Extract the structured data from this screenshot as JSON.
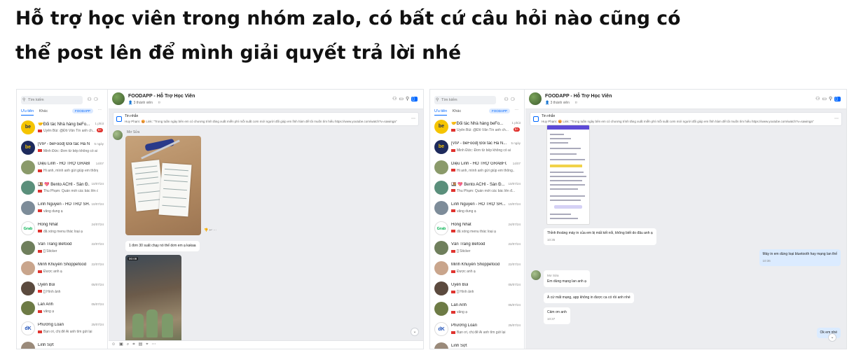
{
  "headline": {
    "line1": "Hỗ trợ học viên trong nhóm zalo, có bất cứ câu hỏi nào cũng có",
    "line2": "thể post lên để mình giải quyết trả lời nhé"
  },
  "sidebar": {
    "search_placeholder": "Tìm kiếm",
    "tab_priority": "Ưu tiên",
    "tab_other": "Khác",
    "label_filter": "FOODAPP",
    "conversations": [
      {
        "avatar": "be",
        "avatar_color": "#f5c400",
        "name": "🤝Đối tác Nhà hàng beFo...",
        "preview": "Uyên Bùi: @Đỗ Văn Tín anh ch...",
        "time": "1 phút",
        "badge": "5+"
      },
      {
        "avatar": "be",
        "avatar_color": "#1d2a5c",
        "name": "[VIP - beFood] Đối tác Hà N...",
        "preview": "Minh Đức: Đơn từ bếp không có ai",
        "time": "5 ngày",
        "badge": ""
      },
      {
        "avatar": "",
        "avatar_color": "#8a9a6a",
        "name": "Diệu Linh - HỖ TRỢ GRABFO...",
        "preview": "Hi anh, mình anh gửi giúp em thông...",
        "time": "14/07",
        "badge": ""
      },
      {
        "avatar": "",
        "avatar_color": "#5a8f7b",
        "name": "🍱 💖 Bento ACHI - Sàn Đ...",
        "preview": "Thu Phạm: Quán mới các bác lên đ...",
        "time": "10/07/24",
        "badge": ""
      },
      {
        "avatar": "",
        "avatar_color": "#7d8c99",
        "name": "Linh Nguyễn - HỖ TRỢ SH...",
        "preview": "vâng dung ạ",
        "time": "10/07/24",
        "badge": ""
      },
      {
        "avatar": "Grab",
        "avatar_color": "#ffffff",
        "name": "Hồng Nhất",
        "preview": "đã xóng menu thác loại ạ",
        "time": "24/07/24",
        "badge": ""
      },
      {
        "avatar": "",
        "avatar_color": "#6f7f5c",
        "name": "Vân Trang Befood",
        "preview": "[] Sticker",
        "time": "22/07/24",
        "badge": ""
      },
      {
        "avatar": "",
        "avatar_color": "#c9a58c",
        "name": "Minh Khuyên Shoppefood",
        "preview": "Được anh ạ",
        "time": "22/07/24",
        "badge": ""
      },
      {
        "avatar": "",
        "avatar_color": "#5b4a3e",
        "name": "Uyên Bùi",
        "preview": "[] Hình ảnh",
        "time": "05/07/24",
        "badge": ""
      },
      {
        "avatar": "",
        "avatar_color": "#6d7b45",
        "name": "Lan Anh",
        "preview": "vâng ạ",
        "time": "05/07/24",
        "badge": ""
      },
      {
        "avatar": "dK",
        "avatar_color": "#ffffff",
        "name": "Phương Loan",
        "preview": "Bạn ơi, chị để Ai anh tìm gửi lại",
        "time": "25/07/24",
        "badge": ""
      },
      {
        "avatar": "",
        "avatar_color": "#9a8a7a",
        "name": "Linh Sợt",
        "preview": "",
        "time": "",
        "badge": ""
      }
    ]
  },
  "chat": {
    "group_name": "FOODAPP - Hỗ Trợ Học Viên",
    "members": "3 thành viên",
    "pinned_title": "Tin nhắn",
    "pinned_text": "Huy Phạm: 😡 Link: \"Trong tuần ngày bên em có chương trình tăng xuất miễn phí mỗi suất cơm mới người đối giúp em lĩnh hàm để tôi muốn tìm hiểu https://www.youtube.com/watch?v=sawinga\"",
    "sender": "Mơ Sửa",
    "photo_caption": "1 đơn 30 suất chạy nó thế dơn em ạ kakaa",
    "video_label": "00:08",
    "reactions": "👎  ↩  ⋯",
    "right_bubbles": [
      {
        "text": "Thỉnh thoảng máy in của em bị mất kết nối, không biết do đâu anh ạ",
        "time": "10:35",
        "me": false
      },
      {
        "text": "Máy in em dùng loại bluetooth hay mạng lan thế",
        "time": "10:36",
        "me": true
      },
      {
        "text": "Em dùng mạng lan anh ạ",
        "time": "",
        "me": false
      },
      {
        "text": "À cứ mất mạng, app không in được ca có rồi anh nhé",
        "time": "",
        "me": false
      },
      {
        "text": "Cảm ơn anh",
        "time": "10:37",
        "me": false
      },
      {
        "text": "Ok em nhé",
        "time": "",
        "me": true
      }
    ]
  }
}
